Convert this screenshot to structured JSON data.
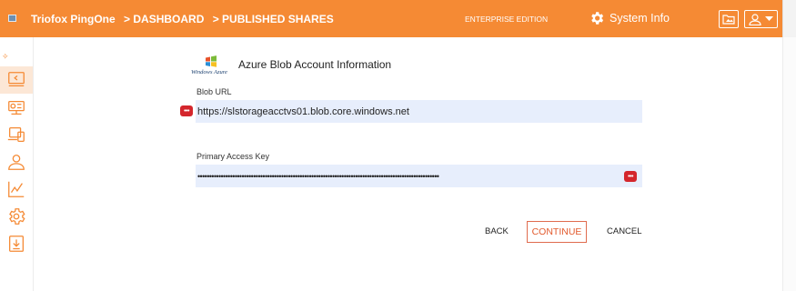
{
  "header": {
    "breadcrumb": [
      "Triofox PingOne",
      "> DASHBOARD",
      "> PUBLISHED SHARES"
    ],
    "edition": "ENTERPRISE EDITION",
    "system_info": "System Info"
  },
  "sidebar": {
    "items": [
      {
        "icon": "share-screen-icon",
        "active": true
      },
      {
        "icon": "server-icon",
        "active": false
      },
      {
        "icon": "devices-icon",
        "active": false
      },
      {
        "icon": "user-icon",
        "active": false
      },
      {
        "icon": "chart-icon",
        "active": false
      },
      {
        "icon": "gear-icon",
        "active": false
      },
      {
        "icon": "download-icon",
        "active": false
      }
    ]
  },
  "main": {
    "logo_text": "Windows Azure",
    "title": "Azure Blob Account Information",
    "blob_url_label": "Blob URL",
    "blob_url_value": "https://slstorageacctvs01.blob.core.windows.net",
    "access_key_label": "Primary Access Key",
    "access_key_value": "••••••••••••••••••••••••••••••••••••••••••••••••••••••••••••••••••••••••••••••••••••••••••••••••••••••••"
  },
  "actions": {
    "back": "BACK",
    "continue": "CONTINUE",
    "cancel": "CANCEL"
  },
  "colors": {
    "accent": "#f58a34",
    "field_bg": "#e7eefc",
    "continue_border": "#e06c4f"
  }
}
